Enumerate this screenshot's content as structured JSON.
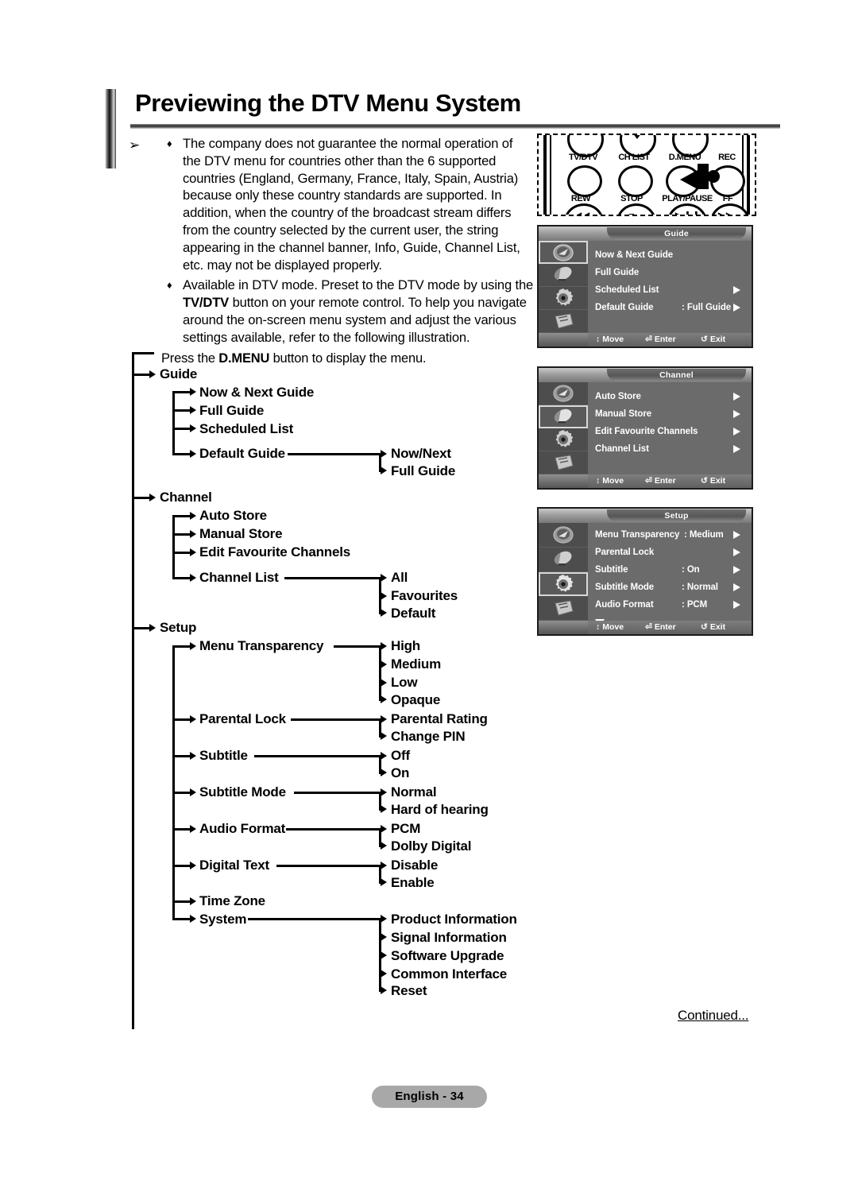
{
  "header": {
    "title": "Previewing the DTV Menu System"
  },
  "notes": {
    "arrow_glyph": "➢",
    "diamond_glyph": "♦",
    "items": [
      {
        "id": "note-1",
        "text": "The company does not guarantee the normal operation of the DTV menu for countries other than the 6 supported countries (England, Germany, France, Italy, Spain, Austria) because only these country standards are supported. In addition, when the country of the broadcast stream differs from the country selected by the current user, the string appearing in the channel banner, Info, Guide, Channel List, etc. may not be displayed properly."
      },
      {
        "id": "note-2",
        "pre": "Available in DTV mode. Preset to the DTV mode by using the ",
        "bold": "TV/DTV",
        "post": " button on your remote control. To help you navigate around the on-screen menu system and adjust the various settings available, refer to the following illustration."
      }
    ]
  },
  "tree": {
    "intro_pre": "Press the ",
    "intro_bold": "D.MENU",
    "intro_post": " button to display the menu.",
    "level1": [
      "Guide",
      "Channel",
      "Setup"
    ],
    "guide_children": [
      "Now & Next Guide",
      "Full Guide",
      "Scheduled List",
      "Default Guide"
    ],
    "guide_default_options": [
      "Now/Next",
      "Full Guide"
    ],
    "channel_children": [
      "Auto Store",
      "Manual Store",
      "Edit Favourite Channels",
      "Channel List"
    ],
    "channel_list_options": [
      "All",
      "Favourites",
      "Default"
    ],
    "setup_children": [
      "Menu Transparency",
      "Parental Lock",
      "Subtitle",
      "Subtitle Mode",
      "Audio Format",
      "Digital Text",
      "Time Zone",
      "System"
    ],
    "menu_transparency_options": [
      "High",
      "Medium",
      "Low",
      "Opaque"
    ],
    "parental_lock_options": [
      "Parental Rating",
      "Change PIN"
    ],
    "subtitle_options": [
      "Off",
      "On"
    ],
    "subtitle_mode_options": [
      "Normal",
      "Hard of hearing"
    ],
    "audio_format_options": [
      "PCM",
      "Dolby Digital"
    ],
    "digital_text_options": [
      "Disable",
      "Enable"
    ],
    "system_options": [
      "Product Information",
      "Signal Information",
      "Software Upgrade",
      "Common Interface",
      "Reset"
    ]
  },
  "remote": {
    "row1_labels": [
      "TV/DTV",
      "CH LIST",
      "D.MENU",
      "REC"
    ],
    "row2_labels": [
      "REW",
      "STOP",
      "PLAY/PAUSE",
      "FF"
    ]
  },
  "osd_common": {
    "footer": {
      "move_glyph": "↕",
      "move_label": "Move",
      "enter_glyph": "⏎",
      "enter_label": "Enter",
      "exit_glyph": "↺",
      "exit_label": "Exit"
    },
    "sidebar_icons": [
      "guide-compass-icon",
      "satellite-dish-icon",
      "gear-setup-icon",
      "remote-input-icon"
    ],
    "arrow_glyph": "▶",
    "down_glyph": "▼"
  },
  "osd_panels": [
    {
      "title": "Guide",
      "selected_icon_index": 0,
      "rows": [
        {
          "label": "Now & Next Guide",
          "value": "",
          "arrow": false
        },
        {
          "label": "Full Guide",
          "value": "",
          "arrow": false
        },
        {
          "label": "Scheduled List",
          "value": "",
          "arrow": true
        },
        {
          "label": "Default Guide",
          "value": ": Full Guide",
          "arrow": true
        }
      ],
      "more": false
    },
    {
      "title": "Channel",
      "selected_icon_index": 1,
      "rows": [
        {
          "label": "Auto Store",
          "value": "",
          "arrow": true
        },
        {
          "label": "Manual Store",
          "value": "",
          "arrow": true
        },
        {
          "label": "Edit Favourite Channels",
          "value": "",
          "arrow": true
        },
        {
          "label": "Channel List",
          "value": "",
          "arrow": true
        }
      ],
      "more": false
    },
    {
      "title": "Setup",
      "selected_icon_index": 2,
      "rows": [
        {
          "label": "Menu Transparency",
          "value": ": Medium",
          "arrow": true
        },
        {
          "label": "Parental Lock",
          "value": "",
          "arrow": true
        },
        {
          "label": "Subtitle",
          "value": ": On",
          "arrow": true
        },
        {
          "label": "Subtitle Mode",
          "value": ": Normal",
          "arrow": true
        },
        {
          "label": "Audio Format",
          "value": ": PCM",
          "arrow": true
        }
      ],
      "more": true
    }
  ],
  "footer": {
    "continued": "Continued...",
    "page_label": "English - 34"
  }
}
